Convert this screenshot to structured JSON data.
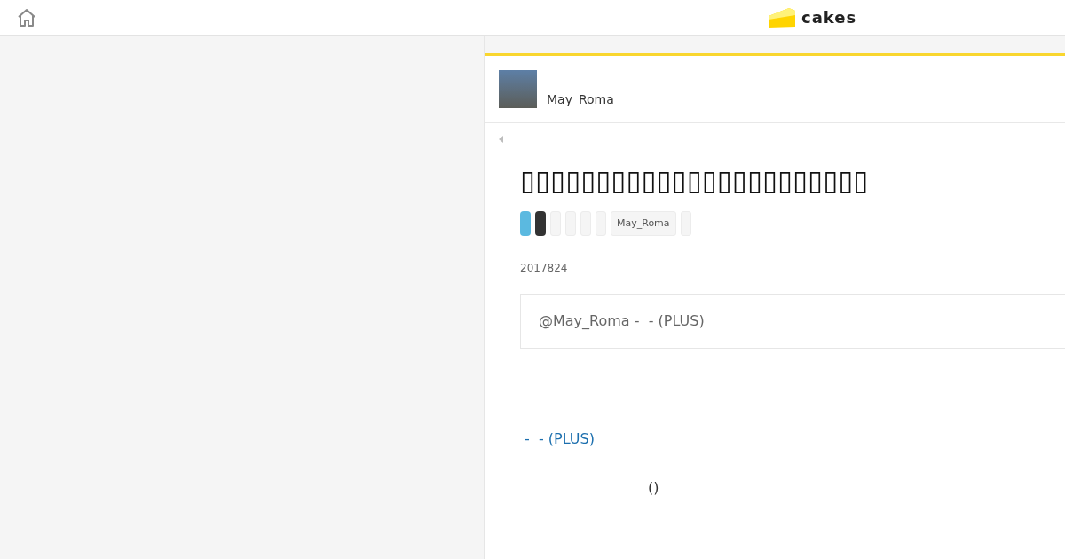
{
  "header": {
    "logo": "cakes"
  },
  "article": {
    "author": {
      "name": "May_Roma"
    },
    "title": "▯▯▯▯▯▯▯▯▯▯▯▯▯▯▯▯▯▯▯▯▯▯▯",
    "tags": [
      {
        "kind": "share",
        "color": "#5bb9e0"
      },
      {
        "kind": "share",
        "color": "#333333"
      },
      {
        "kind": "tag"
      },
      {
        "kind": "tag"
      },
      {
        "kind": "tag"
      },
      {
        "kind": "tag"
      },
      {
        "kind": "tag",
        "label": "May_Roma"
      },
      {
        "kind": "tag"
      }
    ],
    "date": "2017824",
    "summary": "@May_Roma -  - (PLUS)",
    "link": "-  - (PLUS)",
    "caption": "()"
  }
}
